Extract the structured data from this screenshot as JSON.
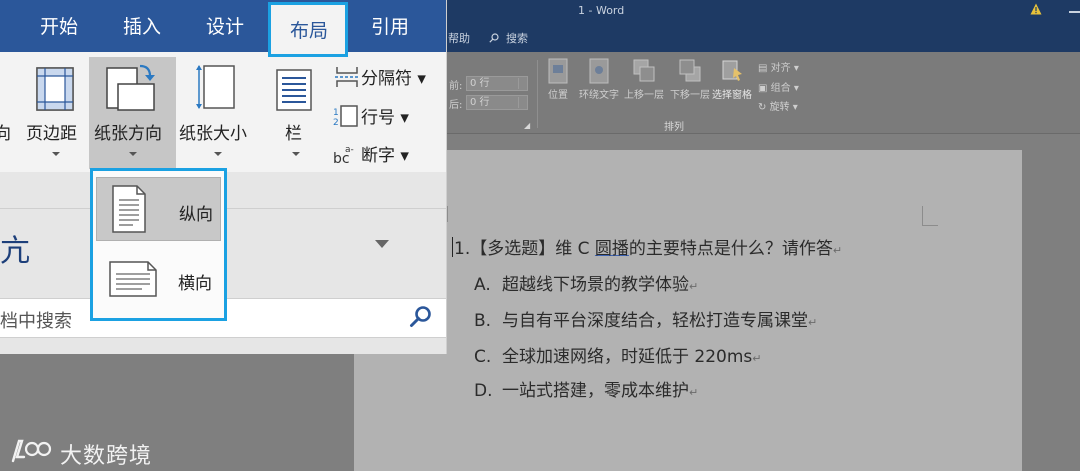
{
  "background_window": {
    "title": "1  -  Word",
    "tabs": [
      "帮助",
      "搜索"
    ],
    "ribbon": {
      "spacing_before_label": "前:",
      "spacing_before_value": "0 行",
      "spacing_after_label": "后:",
      "spacing_after_value": "0 行",
      "arrange_buttons": [
        "位置",
        "环绕文字",
        "上移一层",
        "下移一层",
        "选择窗格"
      ],
      "small_commands": [
        "对齐",
        "组合",
        "旋转"
      ],
      "group_label": "排列"
    }
  },
  "document": {
    "question": {
      "number": "1.",
      "prefix": "【多选题】维 C ",
      "underlined": "圆播",
      "suffix": "的主要特点是什么？请作答",
      "mark": "↵"
    },
    "options": [
      {
        "letter": "A.",
        "text": "超越线下场景的教学体验",
        "mark": "↵"
      },
      {
        "letter": "B.",
        "text": "与自有平台深度结合，轻松打造专属课堂",
        "mark": "↵"
      },
      {
        "letter": "C.",
        "text": "全球加速网络，时延低于 220ms",
        "mark": "↵"
      },
      {
        "letter": "D.",
        "text": "一站式搭建，零成本维护",
        "mark": "↵"
      }
    ]
  },
  "zoom_panel": {
    "tabs": [
      "开始",
      "插入",
      "设计",
      "布局",
      "引用"
    ],
    "active_tab": "布局",
    "ribbon_buttons": {
      "partial_left": "向",
      "margins": "页边距",
      "orientation": "纸张方向",
      "size": "纸张大小",
      "columns": "栏"
    },
    "page_setup_commands": {
      "breaks": "分隔符",
      "line_numbers": "行号",
      "hyphenation": "断字"
    },
    "font_fragment": "亢",
    "search_placeholder": "档中搜索",
    "orientation_menu": {
      "items": [
        {
          "label": "纵向",
          "selected": true
        },
        {
          "label": "横向",
          "selected": false
        }
      ]
    }
  },
  "watermark": {
    "text": "大数跨境"
  },
  "colors": {
    "word_blue": "#2b579a",
    "highlight_cyan": "#1ba1e2",
    "dimmed_titlebar": "#1e3a64"
  }
}
